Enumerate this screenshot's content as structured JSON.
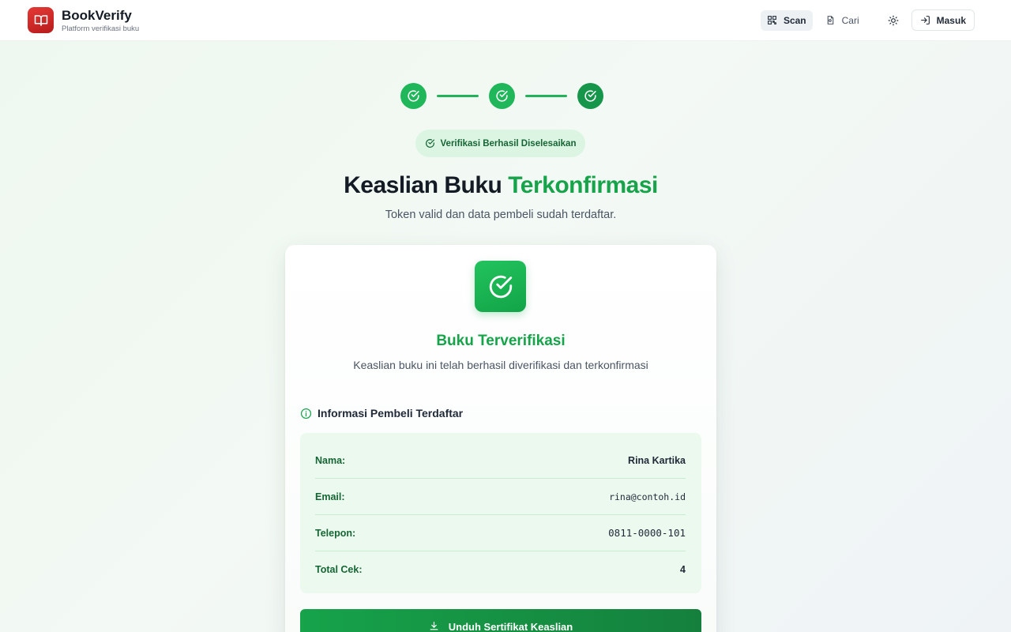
{
  "app": {
    "name": "BookVerify",
    "tagline": "Platform verifikasi buku",
    "brand_color": "#d32f2f",
    "accent_color": "#16a34a"
  },
  "nav": {
    "scan_label": "Scan",
    "search_label": "Cari",
    "login_label": "Masuk"
  },
  "stepper": {
    "steps_completed": 3,
    "steps_total": 3
  },
  "badge": {
    "label": "Verifikasi Berhasil Diselesaikan"
  },
  "hero": {
    "title_main": "Keaslian Buku",
    "title_accent": "Terkonfirmasi",
    "subtitle": "Token valid dan data pembeli sudah terdaftar."
  },
  "card": {
    "icon": "check-circle-icon",
    "title": "Buku Terverifikasi",
    "description": "Keaslian buku ini telah berhasil diverifikasi dan terkonfirmasi",
    "section_title": "Informasi Pembeli Terdaftar",
    "rows": [
      {
        "label": "Nama:",
        "value": "Rina Kartika"
      },
      {
        "label": "Email:",
        "value": "rina@contoh.id"
      },
      {
        "label": "Telepon:",
        "value": "0811-0000-101"
      },
      {
        "label": "Total Cek:",
        "value": "4"
      }
    ],
    "download_label": "Unduh Sertifikat Keaslian"
  }
}
